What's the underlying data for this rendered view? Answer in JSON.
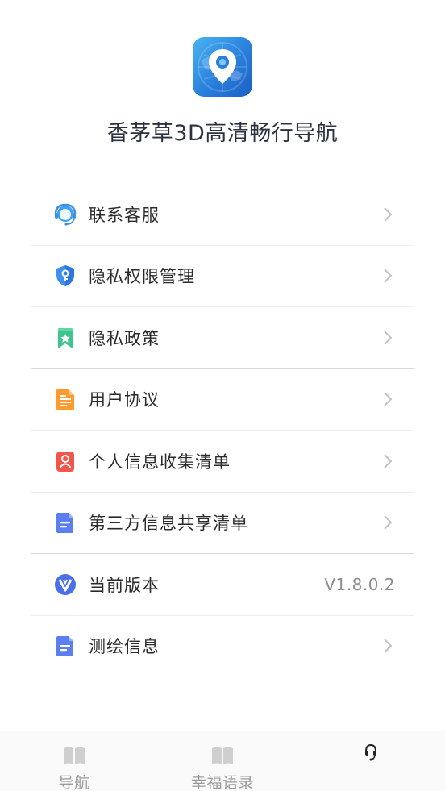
{
  "app": {
    "title": "香茅草3D高清畅行导航",
    "logo_icon": "map-pin-globe-icon"
  },
  "menu": {
    "items": [
      {
        "label": "联系客服",
        "icon": "customer-service-icon"
      },
      {
        "label": "隐私权限管理",
        "icon": "shield-key-icon"
      },
      {
        "label": "隐私政策",
        "icon": "bookmark-star-icon"
      },
      {
        "label": "用户协议",
        "icon": "document-icon"
      },
      {
        "label": "个人信息收集清单",
        "icon": "user-card-icon"
      },
      {
        "label": "第三方信息共享清单",
        "icon": "list-document-icon"
      },
      {
        "label": "当前版本",
        "icon": "version-v-icon",
        "value": "V1.8.0.2"
      },
      {
        "label": "测绘信息",
        "icon": "list-document-icon"
      }
    ]
  },
  "tabbar": {
    "tabs": [
      {
        "label": "导航",
        "icon": "book-icon"
      },
      {
        "label": "幸福语录",
        "icon": "book-icon"
      },
      {
        "label": "",
        "icon": "headset-icon"
      }
    ]
  },
  "colors": {
    "accent_blue": "#2a7fdc",
    "chevron": "#c2c2c2",
    "divider": "#eeeeee",
    "tab_label": "#9a9a9a"
  }
}
